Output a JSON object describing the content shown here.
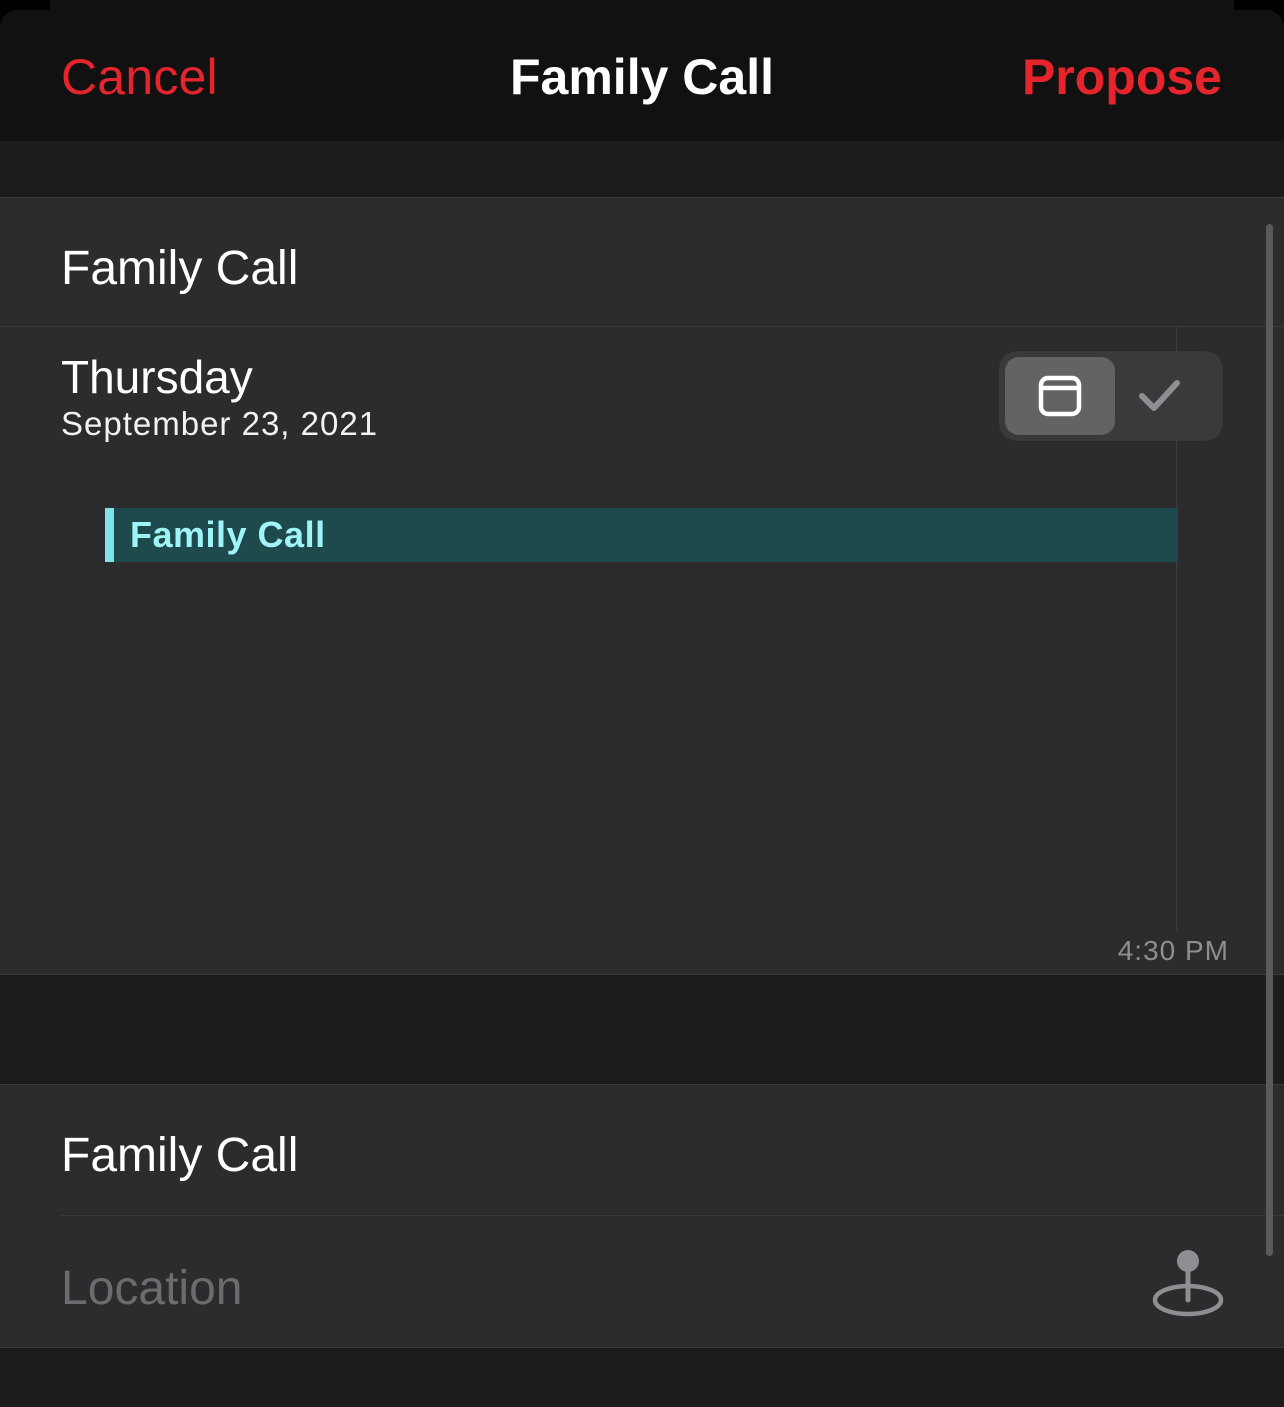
{
  "navbar": {
    "cancel_label": "Cancel",
    "title": "Family Call",
    "propose_label": "Propose"
  },
  "event_card": {
    "title": "Family Call",
    "day": "Thursday",
    "date": "September 23, 2021",
    "view_toggle": {
      "options": [
        "calendar-icon",
        "checkmark-icon"
      ],
      "selected": "calendar-icon"
    },
    "timeline_event": {
      "title": "Family Call",
      "color": "#7fe3e9"
    },
    "time_marker": "4:30 PM"
  },
  "details": {
    "title": "Family Call",
    "location_placeholder": "Location",
    "location_icon": "location-pin-icon"
  },
  "colors": {
    "accent": "#e5252b",
    "background": "#1c1c1e",
    "card": "#2c2c2e"
  }
}
